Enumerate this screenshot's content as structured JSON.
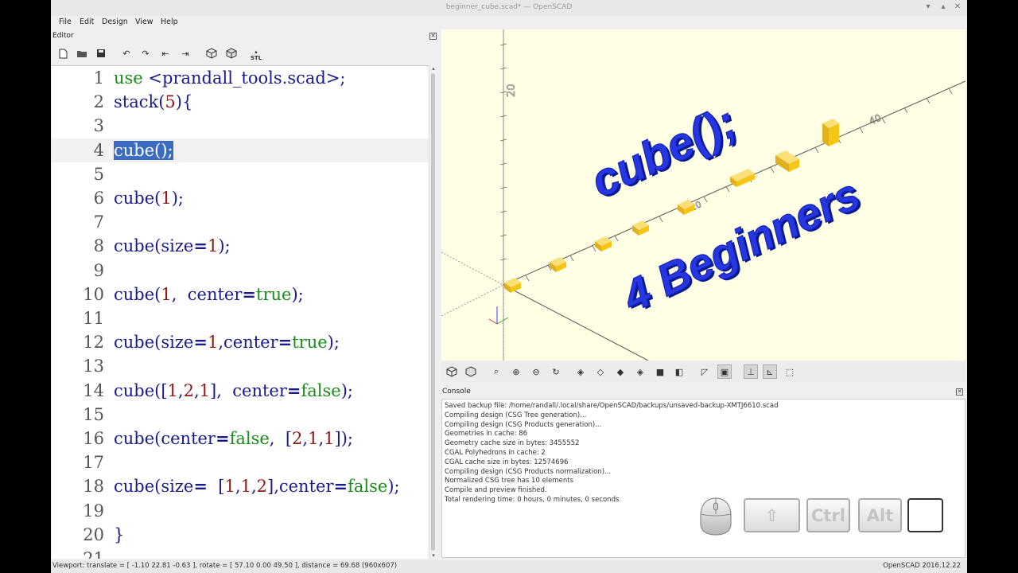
{
  "window": {
    "title": "beginner_cube.scad* — OpenSCAD",
    "minimize": "▾",
    "maximize": "▴",
    "close": "✕"
  },
  "menu": [
    "File",
    "Edit",
    "Design",
    "View",
    "Help"
  ],
  "editor": {
    "panel_label": "Editor",
    "close": "✕",
    "toolbar": {
      "stl_label": "STL",
      "icons": [
        "new-file-icon",
        "open-file-icon",
        "save-icon",
        "undo-icon",
        "redo-icon",
        "unindent-icon",
        "indent-icon",
        "preview-icon",
        "render-icon",
        "export-stl-icon"
      ]
    },
    "lines": [
      {
        "n": "1",
        "tokens": [
          {
            "t": "use",
            "c": "kw"
          },
          {
            "t": " <prandall_tools.scad>;",
            "c": ""
          }
        ]
      },
      {
        "n": "2",
        "tokens": [
          {
            "t": "stack(",
            "c": ""
          },
          {
            "t": "5",
            "c": "num"
          },
          {
            "t": "){",
            "c": ""
          }
        ]
      },
      {
        "n": "3",
        "tokens": []
      },
      {
        "n": "4",
        "tokens": [
          {
            "t": "cube();",
            "c": "sel"
          }
        ],
        "current": true
      },
      {
        "n": "5",
        "tokens": []
      },
      {
        "n": "6",
        "tokens": [
          {
            "t": "cube(",
            "c": ""
          },
          {
            "t": "1",
            "c": "num"
          },
          {
            "t": ");",
            "c": ""
          }
        ]
      },
      {
        "n": "7",
        "tokens": []
      },
      {
        "n": "8",
        "tokens": [
          {
            "t": "cube(size",
            "c": ""
          },
          {
            "t": "=",
            "c": "op"
          },
          {
            "t": "1",
            "c": "num"
          },
          {
            "t": ");",
            "c": ""
          }
        ]
      },
      {
        "n": "9",
        "tokens": []
      },
      {
        "n": "10",
        "tokens": [
          {
            "t": "cube(",
            "c": ""
          },
          {
            "t": "1",
            "c": "num"
          },
          {
            "t": ",  center",
            "c": ""
          },
          {
            "t": "=",
            "c": "op"
          },
          {
            "t": "true",
            "c": "kw"
          },
          {
            "t": ");",
            "c": ""
          }
        ]
      },
      {
        "n": "11",
        "tokens": []
      },
      {
        "n": "12",
        "tokens": [
          {
            "t": "cube(size",
            "c": ""
          },
          {
            "t": "=",
            "c": "op"
          },
          {
            "t": "1",
            "c": "num"
          },
          {
            "t": ",center",
            "c": ""
          },
          {
            "t": "=",
            "c": "op"
          },
          {
            "t": "true",
            "c": "kw"
          },
          {
            "t": ");",
            "c": ""
          }
        ]
      },
      {
        "n": "13",
        "tokens": []
      },
      {
        "n": "14",
        "tokens": [
          {
            "t": "cube([",
            "c": ""
          },
          {
            "t": "1",
            "c": "num"
          },
          {
            "t": ",",
            "c": ""
          },
          {
            "t": "2",
            "c": "num"
          },
          {
            "t": ",",
            "c": ""
          },
          {
            "t": "1",
            "c": "num"
          },
          {
            "t": "],  center",
            "c": ""
          },
          {
            "t": "=",
            "c": "op"
          },
          {
            "t": "false",
            "c": "kw"
          },
          {
            "t": ");",
            "c": ""
          }
        ]
      },
      {
        "n": "15",
        "tokens": []
      },
      {
        "n": "16",
        "tokens": [
          {
            "t": "cube(center",
            "c": ""
          },
          {
            "t": "=",
            "c": "op"
          },
          {
            "t": "false",
            "c": "kw"
          },
          {
            "t": ",  [",
            "c": ""
          },
          {
            "t": "2",
            "c": "num"
          },
          {
            "t": ",",
            "c": ""
          },
          {
            "t": "1",
            "c": "num"
          },
          {
            "t": ",",
            "c": ""
          },
          {
            "t": "1",
            "c": "num"
          },
          {
            "t": "]);",
            "c": ""
          }
        ]
      },
      {
        "n": "17",
        "tokens": []
      },
      {
        "n": "18",
        "tokens": [
          {
            "t": "cube(size",
            "c": ""
          },
          {
            "t": "=",
            "c": "op"
          },
          {
            "t": "  [",
            "c": ""
          },
          {
            "t": "1",
            "c": "num"
          },
          {
            "t": ",",
            "c": ""
          },
          {
            "t": "1",
            "c": "num"
          },
          {
            "t": ",",
            "c": ""
          },
          {
            "t": "2",
            "c": "num"
          },
          {
            "t": "],center",
            "c": ""
          },
          {
            "t": "=",
            "c": "op"
          },
          {
            "t": "false",
            "c": "kw"
          },
          {
            "t": ");",
            "c": ""
          }
        ]
      },
      {
        "n": "19",
        "tokens": []
      },
      {
        "n": "20",
        "tokens": [
          {
            "t": "}",
            "c": ""
          }
        ]
      },
      {
        "n": "21",
        "tokens": []
      }
    ]
  },
  "viewport": {
    "text_line1": "cube();",
    "text_line2": "4 Beginners",
    "axis_tick_labels": [
      "20",
      "10",
      "40",
      "20"
    ],
    "text_color": "#1e2fd6",
    "cube_color": "#f5c518",
    "background": "#ffffe5"
  },
  "view_toolbar": {
    "icons": [
      "preview-icon",
      "render-icon",
      "view-all-icon",
      "zoom-in-icon",
      "zoom-out-icon",
      "reset-view-icon",
      "view-right-icon",
      "view-top-icon",
      "view-bottom-icon",
      "view-left-icon",
      "view-front-icon",
      "view-back-icon",
      "perspective-icon",
      "orthogonal-icon",
      "show-axes-icon",
      "show-scale-icon",
      "show-edges-icon"
    ]
  },
  "console": {
    "panel_label": "Console",
    "close": "✕",
    "messages": [
      "Saved backup file: /home/randall/.local/share/OpenSCAD/backups/unsaved-backup-XMTJ6610.scad",
      "Compiling design (CSG Tree generation)...",
      "Compiling design (CSG Products generation)...",
      "Geometries in cache: 86",
      "Geometry cache size in bytes: 3455552",
      "CGAL Polyhedrons in cache: 2",
      "CGAL cache size in bytes: 12574696",
      "Compiling design (CSG Products normalization)...",
      "Normalized CSG tree has 10 elements",
      "Compile and preview finished.",
      "Total rendering time: 0 hours, 0 minutes, 0 seconds"
    ]
  },
  "keystroke_overlay": {
    "keys": [
      "⇧",
      "Ctrl",
      "Alt",
      ""
    ]
  },
  "statusbar": {
    "viewport_info": "Viewport: translate = [ -1.10 22.81 -0.63 ], rotate = [ 57.10 0.00 49.50 ], distance = 69.68 (960x607)",
    "version": "OpenSCAD 2016.12.22"
  }
}
